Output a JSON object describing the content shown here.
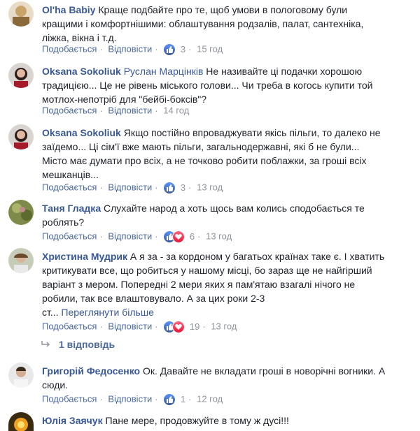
{
  "comments": [
    {
      "author": "Ol'ha Babiy",
      "mention": "",
      "lines": [
        "Краще подбайте про те, щоб умови в пологовому були",
        "кращими і комфортнішими: облаштування родзалів, палат, сантехніка,",
        "ліжка, вікна і т.д."
      ],
      "see_more": "",
      "like_label": "Подобається",
      "reply_label": "Відповісти",
      "reactions": [
        "like"
      ],
      "reaction_count": "3",
      "time": "15 год"
    },
    {
      "author": "Oksana Sokoliuk",
      "mention": "Руслан Марцінків",
      "lines": [
        "Не називайте ці подачки хорошою",
        "традицією... Це не рівень міського голови... Чи треба в когось купити той",
        "мотлох-непотріб для \"бейбі-боксів\"?"
      ],
      "see_more": "",
      "like_label": "Подобається",
      "reply_label": "Відповісти",
      "reactions": [],
      "reaction_count": "",
      "time": "14 год"
    },
    {
      "author": "Oksana Sokoliuk",
      "mention": "",
      "lines": [
        "Якщо постійно впроваджувати якісь пільги, то далеко не",
        "заїдемо... Ці сім'ї вже мають пільги, загальнодержавні, які б не були...",
        "Місто має думати про всіх, а не точково робити поблажки, за гроші всіх",
        "мешканців..."
      ],
      "see_more": "",
      "like_label": "Подобається",
      "reply_label": "Відповісти",
      "reactions": [
        "like"
      ],
      "reaction_count": "3",
      "time": "13 год"
    },
    {
      "author": "Таня Гладка",
      "mention": "",
      "lines": [
        "Слухайте народ а хоть щось вам колись сподобається те",
        "роблять?"
      ],
      "see_more": "",
      "like_label": "Подобається",
      "reply_label": "Відповісти",
      "reactions": [
        "like",
        "love"
      ],
      "reaction_count": "6",
      "time": "13 год"
    },
    {
      "author": "Христина Мудрик",
      "mention": "",
      "lines": [
        "А я за - за кордоном у багатьох країнах таке є. І хватить",
        "критикувати все, що робиться у нашому місці, бо зараз ще не найгірший",
        "варіант з мером. Попередні 2 мери яких я пам'ятаю взагалі нічого не",
        "робили, так все влаштовувало. А за цих роки 2-3",
        "ст..."
      ],
      "see_more": "Переглянути більше",
      "like_label": "Подобається",
      "reply_label": "Відповісти",
      "reactions": [
        "like",
        "love"
      ],
      "reaction_count": "19",
      "time": "13 год"
    },
    {
      "author": "Григорій Федосенко",
      "mention": "",
      "lines": [
        "Ок. Давайте не вкладати гроші в новорічні вогники. А",
        "сюди."
      ],
      "see_more": "",
      "like_label": "Подобається",
      "reply_label": "Відповісти",
      "reactions": [
        "like"
      ],
      "reaction_count": "1",
      "time": "12 год"
    },
    {
      "author": "Юлія Заячук",
      "mention": "",
      "lines": [
        "Пане мере, продовжуйте в тому ж дусі!!!"
      ],
      "see_more": "",
      "like_label": "",
      "reply_label": "",
      "reactions": [],
      "reaction_count": "",
      "time": ""
    }
  ],
  "replies_toggle": "1 відповідь",
  "colors": {
    "link": "#385898",
    "meta": "#90949c",
    "text": "#1d2129"
  }
}
